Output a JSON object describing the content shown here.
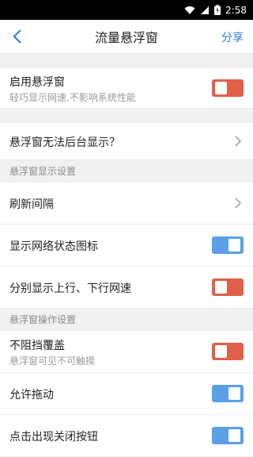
{
  "status": {
    "time": "2:58"
  },
  "nav": {
    "title": "流量悬浮窗",
    "share": "分享"
  },
  "rows": {
    "enable": {
      "label": "启用悬浮窗",
      "sub": "轻巧显示网速,不影响系统性能",
      "on": false
    },
    "background": {
      "label": "悬浮窗无法后台显示？"
    },
    "refresh": {
      "label": "刷新间隔"
    },
    "net_icon": {
      "label": "显示网络状态图标",
      "on": true
    },
    "split": {
      "label": "分别显示上行、下行网速",
      "on": false
    },
    "no_block": {
      "label": "不阻挡覆盖",
      "sub": "悬浮窗可见不可触摸",
      "on": false
    },
    "drag": {
      "label": "允许拖动",
      "on": true
    },
    "close_btn": {
      "label": "点击出现关闭按钮",
      "on": true
    }
  },
  "sections": {
    "display": "悬浮窗显示设置",
    "operation": "悬浮窗操作设置"
  },
  "colors": {
    "accent": "#2b7de0",
    "toggle_on": "#5aa0e8",
    "toggle_off": "#e0604a"
  }
}
